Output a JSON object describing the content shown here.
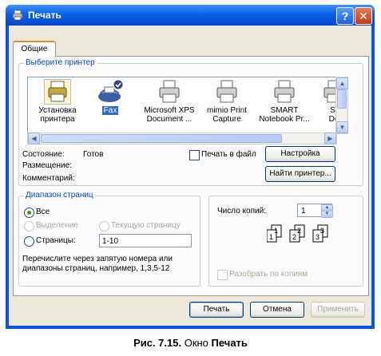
{
  "window": {
    "title": "Печать",
    "help_label": "?",
    "close_label": "✕"
  },
  "tabs": [
    {
      "label": "Общие"
    }
  ],
  "printer_group": {
    "legend": "Выберите принтер",
    "printers": [
      {
        "line1": "Установка",
        "line2": "принтера",
        "icon": "add-printer-icon"
      },
      {
        "line1": "Fax",
        "line2": "",
        "icon": "fax-icon",
        "selected": true
      },
      {
        "line1": "Microsoft XPS",
        "line2": "Document ...",
        "icon": "printer-icon"
      },
      {
        "line1": "mimio Print",
        "line2": "Capture",
        "icon": "printer-icon"
      },
      {
        "line1": "SMART",
        "line2": "Notebook Pr...",
        "icon": "printer-icon"
      },
      {
        "line1": "St",
        "line2": "Do",
        "icon": "printer-icon"
      }
    ],
    "status_label": "Состояние:",
    "status_value": "Готов",
    "location_label": "Размещение:",
    "comment_label": "Комментарий:",
    "print_to_file_label": "Печать в файл",
    "settings_button": "Настройка",
    "find_printer_button": "Найти принтер..."
  },
  "range_group": {
    "legend": "Диапазон страниц",
    "all_label": "Все",
    "selection_label": "Выделение",
    "current_page_label": "Текущую страницу",
    "pages_label": "Страницы:",
    "pages_value": "1-10",
    "hint": "Перечислите через запятую номера или диапазоны страниц, например, 1,3,5-12"
  },
  "copies": {
    "label": "Число копий:",
    "value": "1",
    "collate_label": "Разобрать по копиям"
  },
  "footer": {
    "print_button": "Печать",
    "cancel_button": "Отмена",
    "apply_button": "Применить"
  },
  "caption": {
    "prefix": "Рис. 7.15.",
    "middle": " Окно ",
    "bold_word": "Печать"
  }
}
